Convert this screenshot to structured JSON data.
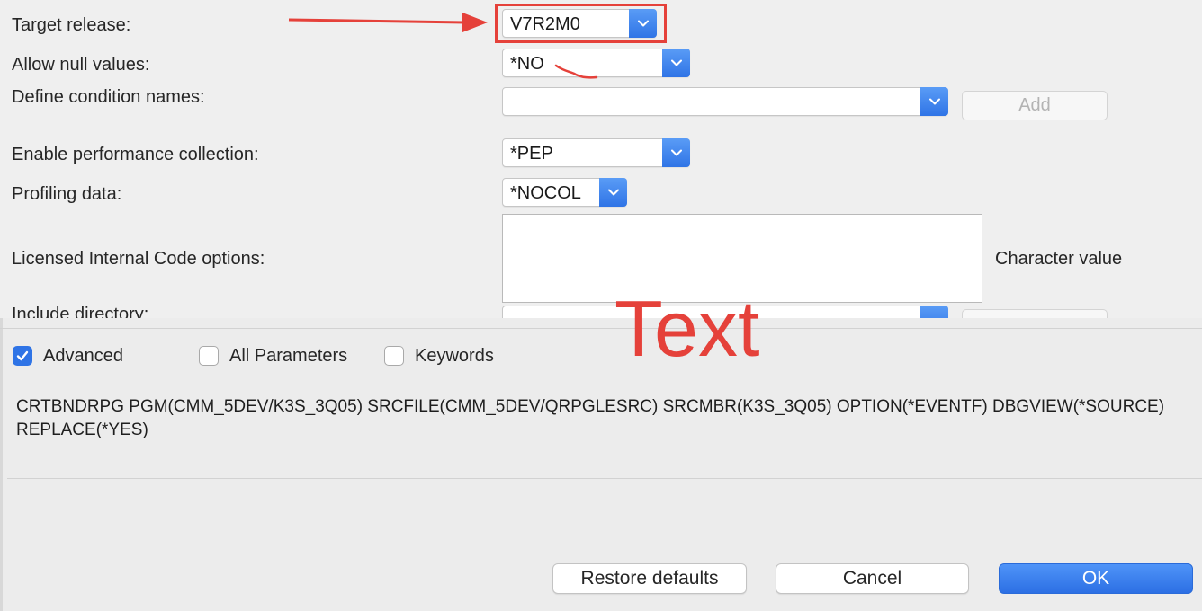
{
  "form": {
    "target_release": {
      "label": "Target release:",
      "value": "V7R2M0"
    },
    "allow_null": {
      "label": "Allow null values:",
      "value": "*NO"
    },
    "define_condition": {
      "label": "Define condition names:",
      "value": "",
      "add_label": "Add"
    },
    "perf_collection": {
      "label": "Enable performance collection:",
      "value": "*PEP"
    },
    "profiling": {
      "label": "Profiling data:",
      "value": "*NOCOL"
    },
    "lic_code": {
      "label": "Licensed Internal Code options:",
      "hint": "Character value"
    },
    "include_dir": {
      "label": "Include directory:"
    }
  },
  "options": {
    "advanced": {
      "label": "Advanced",
      "checked": true
    },
    "all_parameters": {
      "label": "All Parameters",
      "checked": false
    },
    "keywords": {
      "label": "Keywords",
      "checked": false
    }
  },
  "command_text": "CRTBNDRPG PGM(CMM_5DEV/K3S_3Q05) SRCFILE(CMM_5DEV/QRPGLESRC) SRCMBR(K3S_3Q05) OPTION(*EVENTF) DBGVIEW(*SOURCE) REPLACE(*YES)",
  "footer": {
    "restore_label": "Restore defaults",
    "cancel_label": "Cancel",
    "ok_label": "OK"
  },
  "annotation": {
    "overlay_text": "Text",
    "color": "#e5413a"
  },
  "colors": {
    "accent": "#2f74e6",
    "annotation_red": "#e5413a"
  },
  "icons": {
    "combo_arrow": "chevron-down-icon",
    "check": "checkmark-icon"
  }
}
